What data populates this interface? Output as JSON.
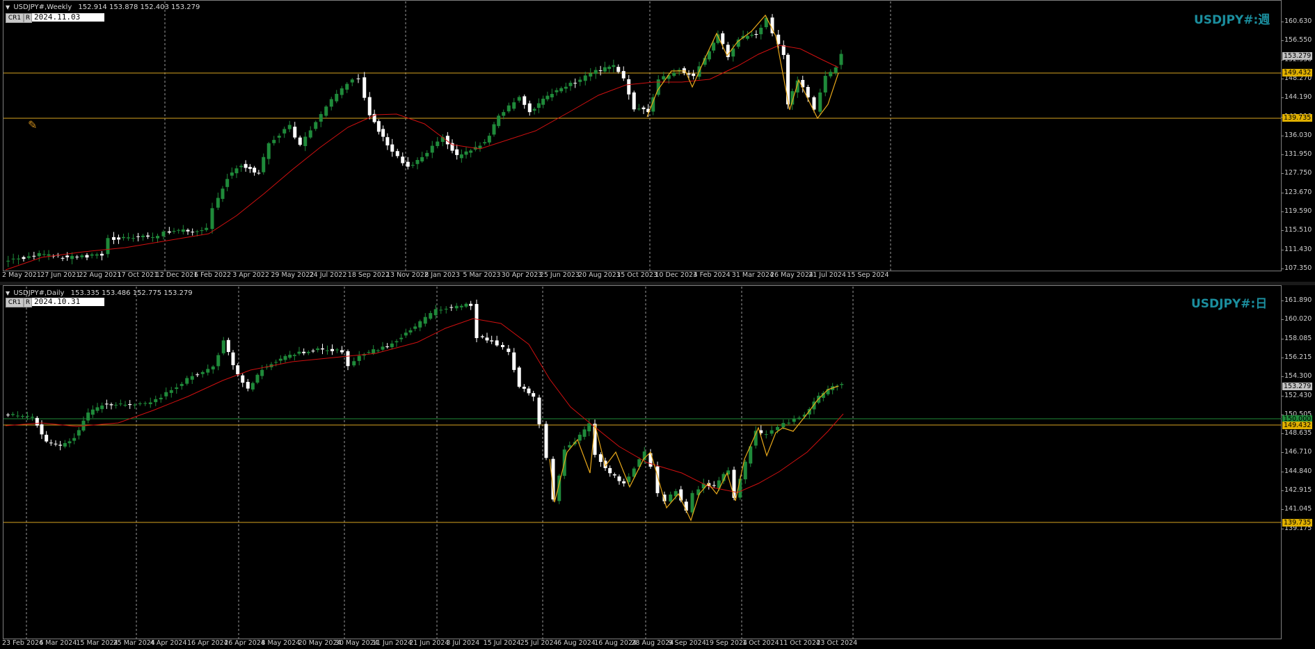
{
  "weekly": {
    "title": "USDJPY#,Weekly",
    "ohlc": "152.914 153.878 152.403 153.279",
    "cr_button": "CR1",
    "r_button": "R",
    "date_value": "2024.11.03 00:00",
    "symbol_label": "USDJPY#:週",
    "y_ticks": [
      "160.630",
      "156.550",
      "152.350",
      "148.270",
      "144.190",
      "140.110",
      "136.030",
      "131.950",
      "127.750",
      "123.670",
      "119.590",
      "115.510",
      "111.430",
      "107.350"
    ],
    "x_ticks": [
      "2 May 2021",
      "27 Jun 2021",
      "22 Aug 2021",
      "17 Oct 2021",
      "12 Dec 2021",
      "6 Feb 2022",
      "3 Apr 2022",
      "29 May 2022",
      "24 Jul 2022",
      "18 Sep 2022",
      "13 Nov 2022",
      "8 Jan 2023",
      "5 Mar 2023",
      "30 Apr 2023",
      "25 Jun 2023",
      "20 Aug 2023",
      "15 Oct 2023",
      "10 Dec 2023",
      "4 Feb 2024",
      "31 Mar 2024",
      "26 May 2024",
      "21 Jul 2024",
      "15 Sep 2024"
    ],
    "current_price": "153.279",
    "hline_1": "149.432",
    "hline_2": "139.735"
  },
  "daily": {
    "title": "USDJPY#,Daily",
    "ohlc": "153.335 153.486 152.775 153.279",
    "cr_button": "CR1",
    "r_button": "R",
    "date_value": "2024.10.31 00:00",
    "symbol_label": "USDJPY#:日",
    "y_ticks": [
      "161.890",
      "160.020",
      "158.085",
      "156.215",
      "154.300",
      "152.430",
      "150.505",
      "148.635",
      "146.710",
      "144.840",
      "142.915",
      "141.045",
      "139.175"
    ],
    "x_ticks": [
      "23 Feb 2024",
      "6 Mar 2024",
      "15 Mar 2024",
      "25 Mar 2024",
      "4 Apr 2024",
      "16 Apr 2024",
      "26 Apr 2024",
      "8 May 2024",
      "20 May 2024",
      "30 May 2024",
      "11 Jun 2024",
      "21 Jun 2024",
      "3 Jul 2024",
      "15 Jul 2024",
      "25 Jul 2024",
      "6 Aug 2024",
      "16 Aug 2024",
      "28 Aug 2024",
      "9 Sep 2024",
      "19 Sep 2024",
      "1 Oct 2024",
      "11 Oct 2024",
      "23 Oct 2024"
    ],
    "current_price": "153.279",
    "green_line": "150.000",
    "hline_1": "149.432",
    "hline_2": "139.735"
  },
  "colors": {
    "bull": "#1f8a3a",
    "bear": "#ffffff",
    "ma": "#d01010",
    "zigzag": "#e8a81a",
    "hline": "#d8a420",
    "grid": "#9a9a9a",
    "label": "#1b8e9e"
  },
  "icons": {
    "tool": "pencil-tool-icon",
    "menu": "dropdown-triangle-icon"
  }
}
